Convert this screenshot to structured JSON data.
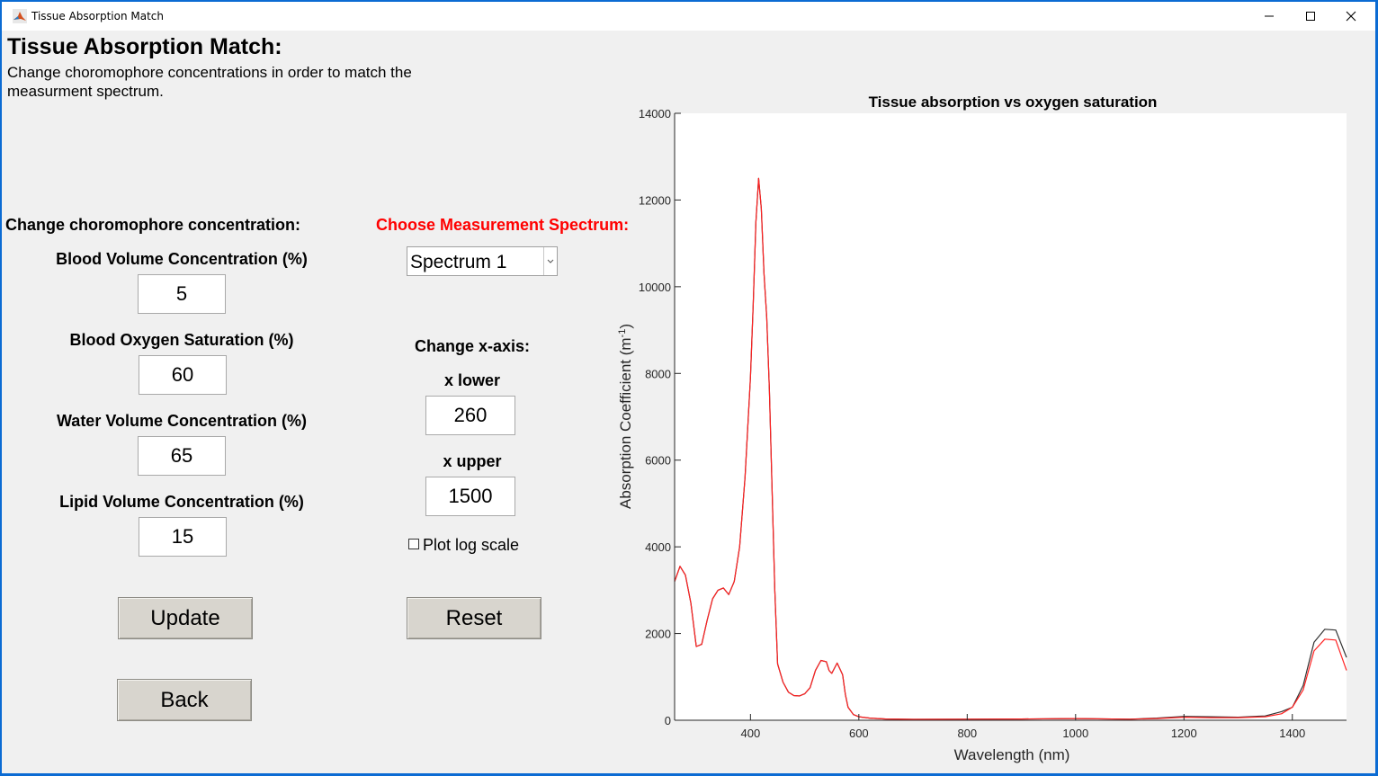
{
  "window": {
    "title": "Tissue Absorption Match",
    "minimize_glyph": "—",
    "maximize_glyph": "☐",
    "close_glyph": "✕"
  },
  "header": {
    "title": "Tissue Absorption Match:",
    "subtitle": "Change choromophore concentrations in order to match the measurment spectrum."
  },
  "concentration": {
    "section_label": "Change choromophore concentration:",
    "fields": [
      {
        "label": "Blood Volume Concentration (%)",
        "value": "5"
      },
      {
        "label": "Blood Oxygen Saturation (%)",
        "value": "60"
      },
      {
        "label": "Water Volume Concentration (%)",
        "value": "65"
      },
      {
        "label": "Lipid Volume Concentration (%)",
        "value": "15"
      }
    ]
  },
  "spectrum": {
    "label": "Choose Measurement Spectrum:",
    "label_color": "#ff0000",
    "selected": "Spectrum 1"
  },
  "xaxis": {
    "section_label": "Change x-axis:",
    "lower_label": "x lower",
    "lower_value": "260",
    "upper_label": "x upper",
    "upper_value": "1500",
    "log_label": "Plot log scale",
    "log_checked": false
  },
  "buttons": {
    "update": "Update",
    "reset": "Reset",
    "back": "Back"
  },
  "icons": {
    "app": "matlab-icon",
    "dropdown": "chevron-down-icon"
  },
  "chart_data": {
    "type": "line",
    "title": "Tissue absorption vs oxygen saturation",
    "xlabel": "Wavelength (nm)",
    "ylabel_main": "Absorption Coefficient (m",
    "ylabel_sup": "-1",
    "ylabel_end": ")",
    "xlim": [
      260,
      1500
    ],
    "ylim": [
      0,
      14000
    ],
    "xticks": [
      400,
      600,
      800,
      1000,
      1200,
      1400
    ],
    "yticks": [
      0,
      2000,
      4000,
      6000,
      8000,
      10000,
      12000,
      14000
    ],
    "grid": false,
    "series": [
      {
        "color": "#333333",
        "x": [
          260,
          270,
          280,
          290,
          300,
          310,
          320,
          330,
          340,
          350,
          360,
          370,
          380,
          390,
          400,
          405,
          410,
          415,
          420,
          425,
          430,
          435,
          440,
          445,
          450,
          460,
          470,
          480,
          490,
          500,
          510,
          520,
          530,
          540,
          545,
          550,
          560,
          570,
          575,
          580,
          590,
          600,
          620,
          650,
          700,
          800,
          900,
          1000,
          1100,
          1150,
          1200,
          1250,
          1300,
          1350,
          1380,
          1400,
          1420,
          1440,
          1460,
          1480,
          1500
        ],
        "y": [
          3200,
          3550,
          3350,
          2700,
          1700,
          1750,
          2300,
          2800,
          3000,
          3050,
          2900,
          3200,
          4000,
          5600,
          7900,
          9600,
          11500,
          12500,
          11800,
          10300,
          9300,
          7600,
          5300,
          3000,
          1300,
          880,
          650,
          570,
          560,
          610,
          750,
          1150,
          1380,
          1350,
          1150,
          1080,
          1320,
          1050,
          600,
          300,
          130,
          80,
          50,
          30,
          20,
          25,
          30,
          40,
          25,
          50,
          90,
          80,
          70,
          100,
          200,
          300,
          800,
          1800,
          2100,
          2080,
          1450
        ]
      },
      {
        "color": "#ff2020",
        "x": [
          260,
          270,
          280,
          290,
          300,
          310,
          320,
          330,
          340,
          350,
          360,
          370,
          380,
          390,
          400,
          405,
          410,
          415,
          420,
          425,
          430,
          435,
          440,
          445,
          450,
          460,
          470,
          480,
          490,
          500,
          510,
          520,
          530,
          540,
          545,
          550,
          560,
          570,
          575,
          580,
          590,
          600,
          620,
          650,
          700,
          800,
          900,
          1000,
          1100,
          1150,
          1200,
          1250,
          1300,
          1350,
          1380,
          1400,
          1420,
          1440,
          1460,
          1480,
          1500
        ],
        "y": [
          3200,
          3550,
          3350,
          2700,
          1700,
          1750,
          2300,
          2800,
          3000,
          3050,
          2900,
          3200,
          4000,
          5600,
          7900,
          9600,
          11500,
          12500,
          11800,
          10300,
          9300,
          7600,
          5300,
          3000,
          1300,
          880,
          650,
          570,
          560,
          610,
          750,
          1150,
          1380,
          1350,
          1150,
          1080,
          1320,
          1050,
          600,
          300,
          130,
          80,
          50,
          30,
          20,
          25,
          30,
          40,
          25,
          40,
          70,
          60,
          60,
          80,
          150,
          300,
          700,
          1600,
          1870,
          1850,
          1150
        ]
      }
    ]
  }
}
